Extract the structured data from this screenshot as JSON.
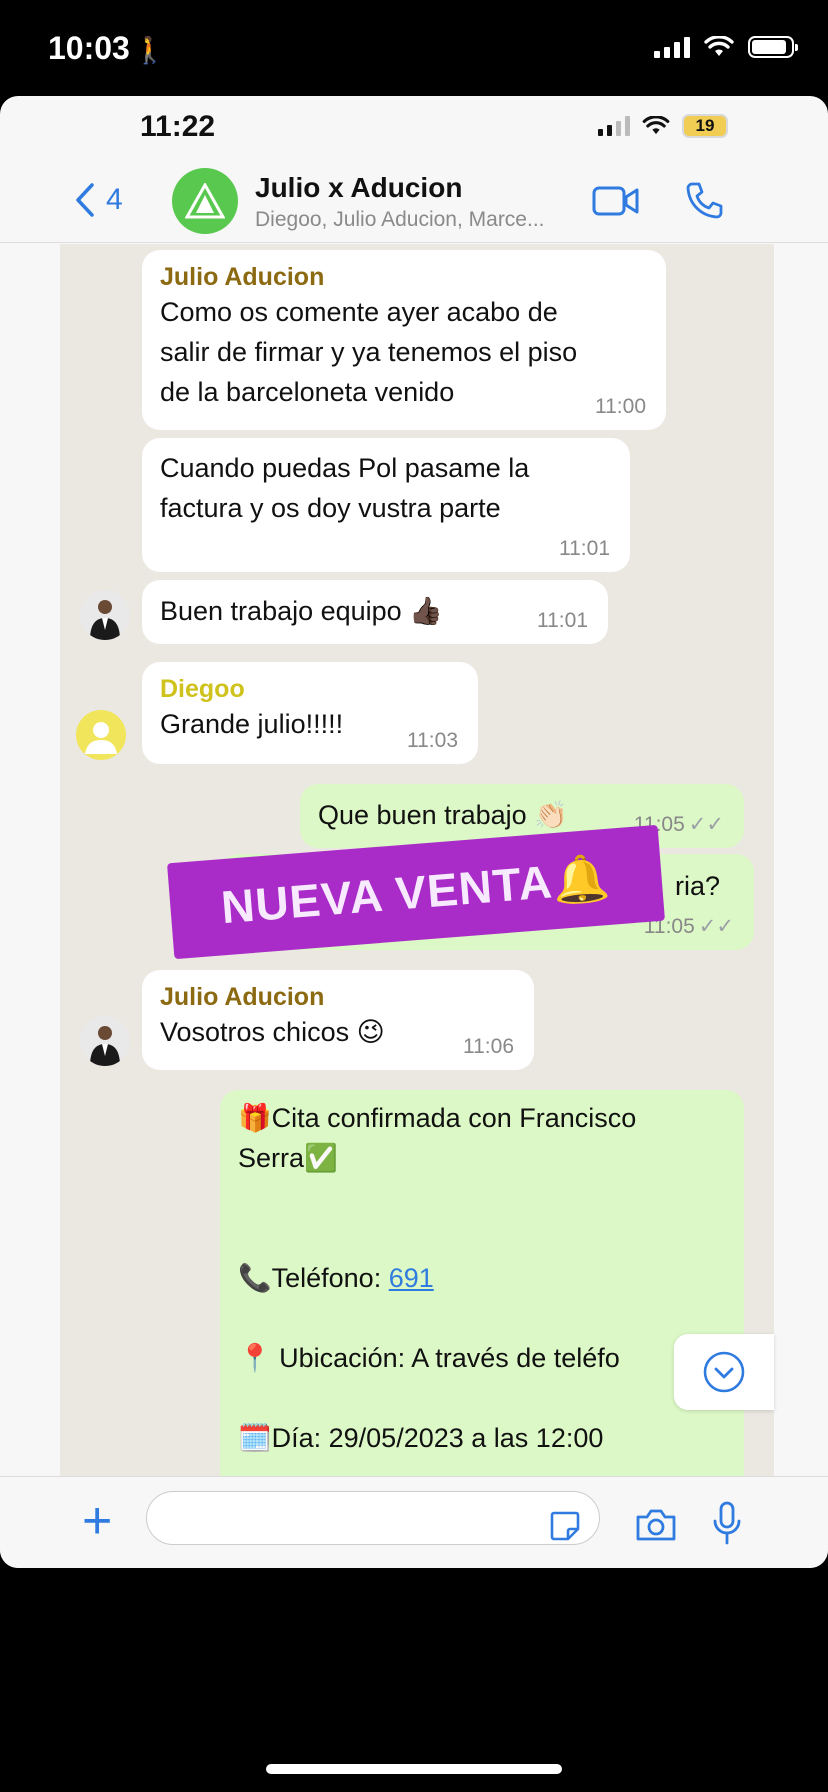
{
  "status_bar": {
    "time": "10:03",
    "person_glyph": "🚶"
  },
  "inner_status": {
    "time": "11:22",
    "battery": "19"
  },
  "header": {
    "back_count": "4",
    "title": "Julio x Aducion",
    "subtitle": "Diegoo, Julio Aducion, Marce..."
  },
  "messages": [
    {
      "sender": "Julio Aducion",
      "text_lines": [
        "Como os comente ayer acabo de",
        "salir de firmar y ya tenemos el piso",
        "de la barceloneta venido"
      ],
      "time": "11:00"
    },
    {
      "text_lines": [
        "Cuando puedas Pol pasame la",
        "factura y os doy vustra parte"
      ],
      "time": "11:01"
    },
    {
      "text": "Buen trabajo equipo 👍🏿",
      "time": "11:01"
    },
    {
      "sender": "Diegoo",
      "text": "Grande julio!!!!!",
      "time": "11:03"
    },
    {
      "text": "Que buen trabajo 👏🏻",
      "time": "11:05"
    },
    {
      "text": "ria?",
      "time": "11:05"
    },
    {
      "sender": "Julio Aducion",
      "text": "Vosotros chicos 😉",
      "time": "11:06"
    }
  ],
  "appointment": {
    "line1": "🎁Cita confirmada con Francisco",
    "line2": "Serra✅",
    "phone_label": "📞Teléfono: ",
    "phone_value": "691",
    "location": "📍 Ubicación: A través de teléfo",
    "date": "🗓️Día: 29/05/2023 a las 12:00"
  },
  "banner": {
    "text": "NUEVA VENTA🔔"
  },
  "colors": {
    "accent": "#2f7be0",
    "outgoing": "#dcf8c6",
    "banner": "#a92cc8",
    "sender_julio": "#8c6a12",
    "sender_diegoo": "#cfc21c"
  },
  "icons": [
    "back-chevron-icon",
    "video-call-icon",
    "phone-call-icon",
    "plus-icon",
    "sticker-icon",
    "camera-icon",
    "microphone-icon",
    "scroll-down-icon"
  ]
}
